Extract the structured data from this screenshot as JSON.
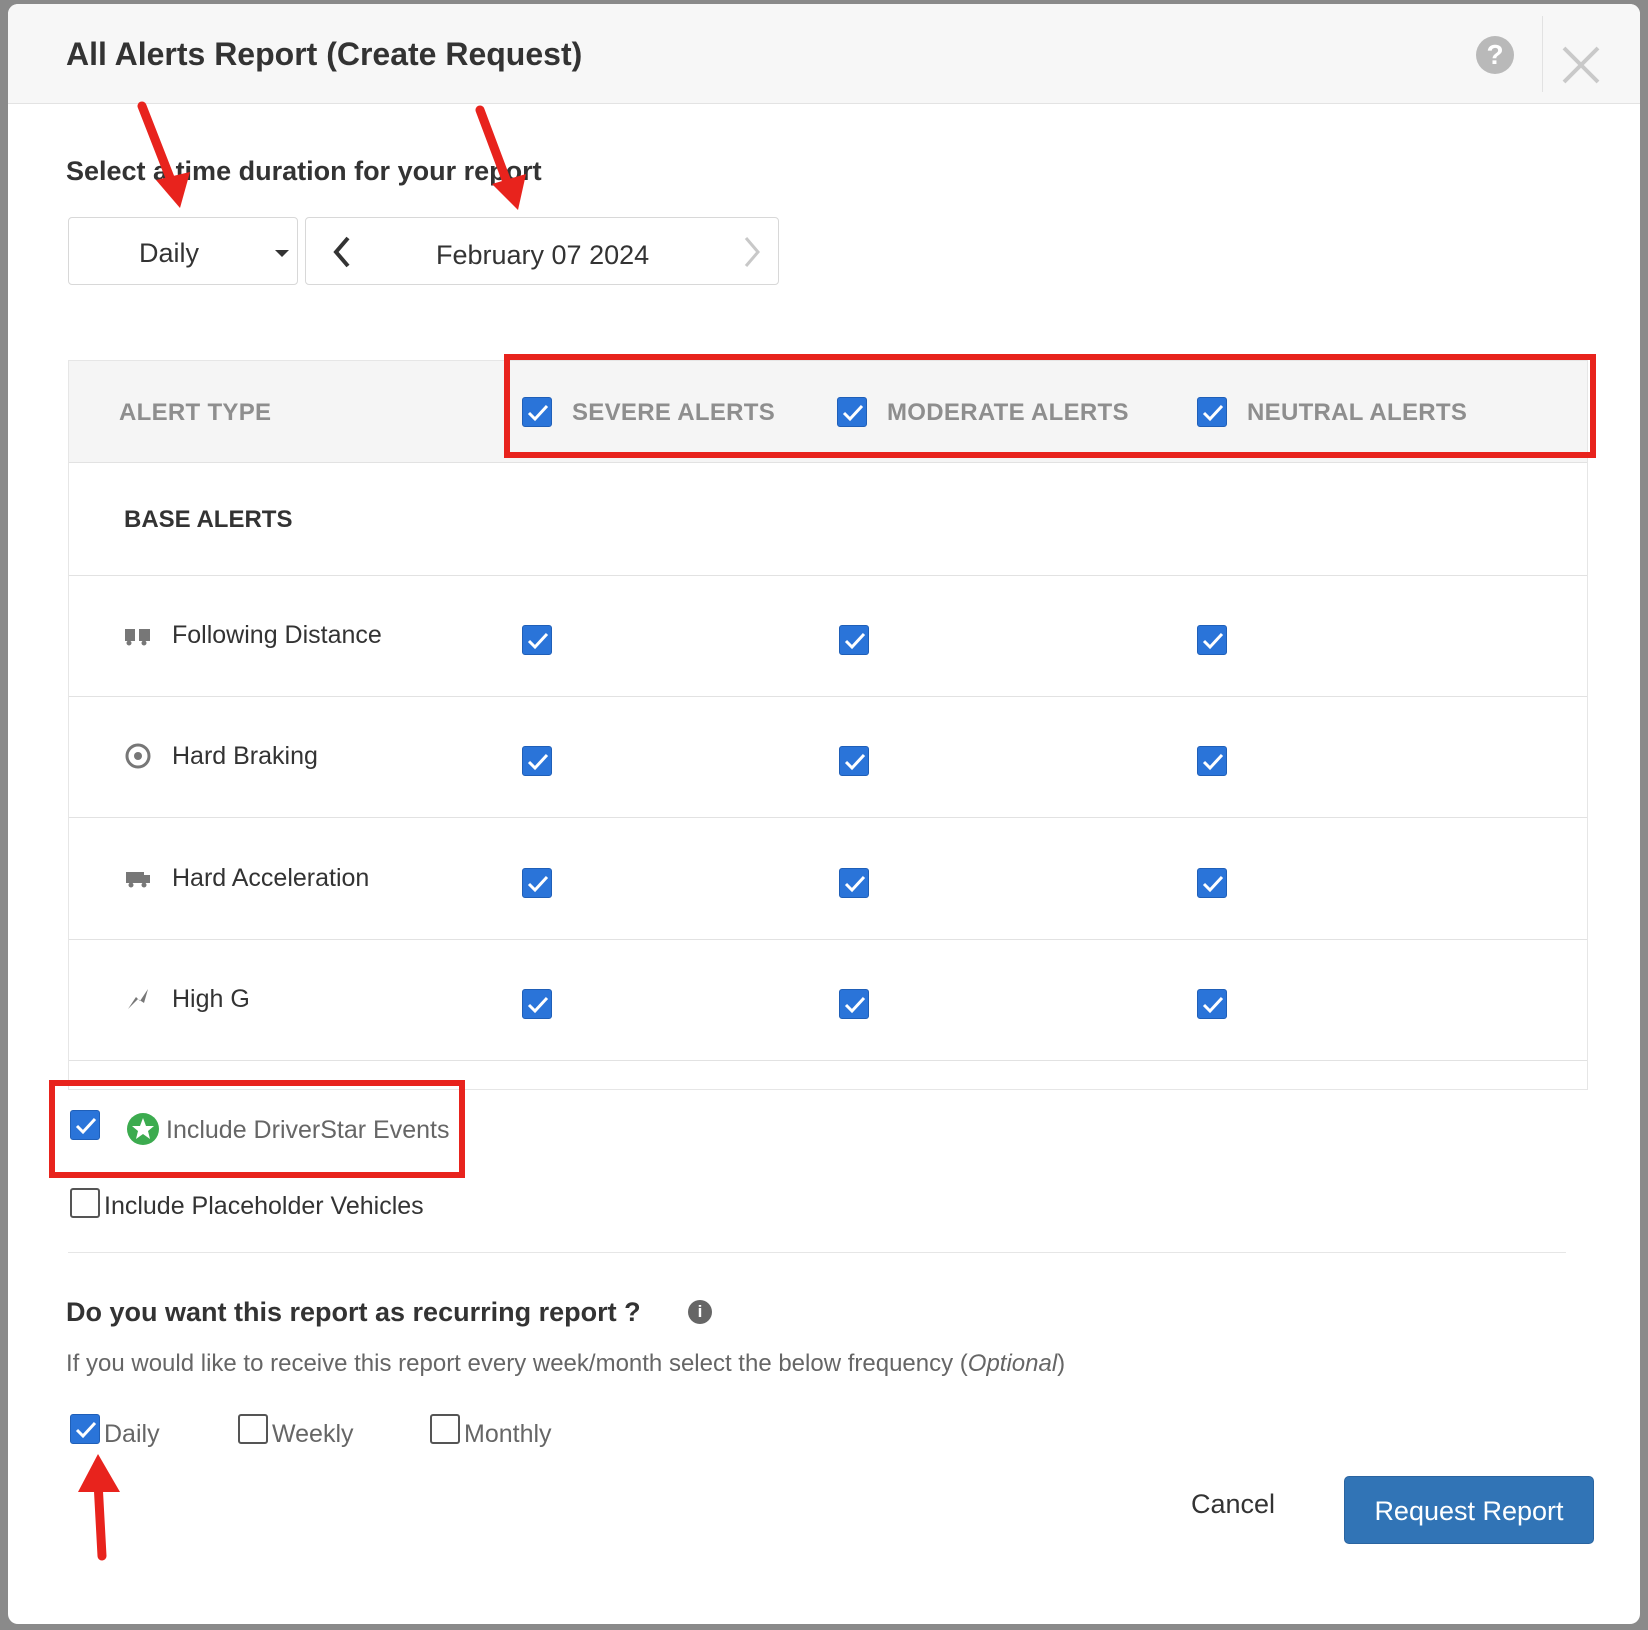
{
  "modal": {
    "title": "All Alerts Report (Create Request)",
    "help_icon": "?"
  },
  "duration": {
    "label": "Select a time duration for your report",
    "frequency_value": "Daily",
    "date_value": "February 07 2024"
  },
  "table": {
    "header": {
      "alert_type": "ALERT TYPE",
      "severe": "SEVERE ALERTS",
      "moderate": "MODERATE ALERTS",
      "neutral": "NEUTRAL ALERTS"
    },
    "group_label": "BASE ALERTS",
    "rows": [
      {
        "label": "Following Distance",
        "icon": "following-distance-icon",
        "severe": true,
        "moderate": true,
        "neutral": true
      },
      {
        "label": "Hard Braking",
        "icon": "hard-braking-icon",
        "severe": true,
        "moderate": true,
        "neutral": true
      },
      {
        "label": "Hard Acceleration",
        "icon": "hard-acceleration-icon",
        "severe": true,
        "moderate": true,
        "neutral": true
      },
      {
        "label": "High G",
        "icon": "high-g-icon",
        "severe": true,
        "moderate": true,
        "neutral": true
      }
    ]
  },
  "options": {
    "driverstar_label": "Include DriverStar Events",
    "driverstar_checked": true,
    "placeholder_label": "Include Placeholder Vehicles",
    "placeholder_checked": false
  },
  "recurring": {
    "question": "Do you want this report as recurring report ?",
    "info_icon": "i",
    "help_text": "If you would like to receive this report every week/month select the below frequency (",
    "help_optional": "Optional",
    "help_close": ")",
    "options": [
      {
        "label": "Daily",
        "checked": true
      },
      {
        "label": "Weekly",
        "checked": false
      },
      {
        "label": "Monthly",
        "checked": false
      }
    ]
  },
  "footer": {
    "cancel_label": "Cancel",
    "request_label": "Request Report"
  },
  "colors": {
    "accent": "#2a74d9",
    "primary_button": "#3174b6",
    "annotation": "#e8231d",
    "driverstar_green": "#3cab4f"
  }
}
